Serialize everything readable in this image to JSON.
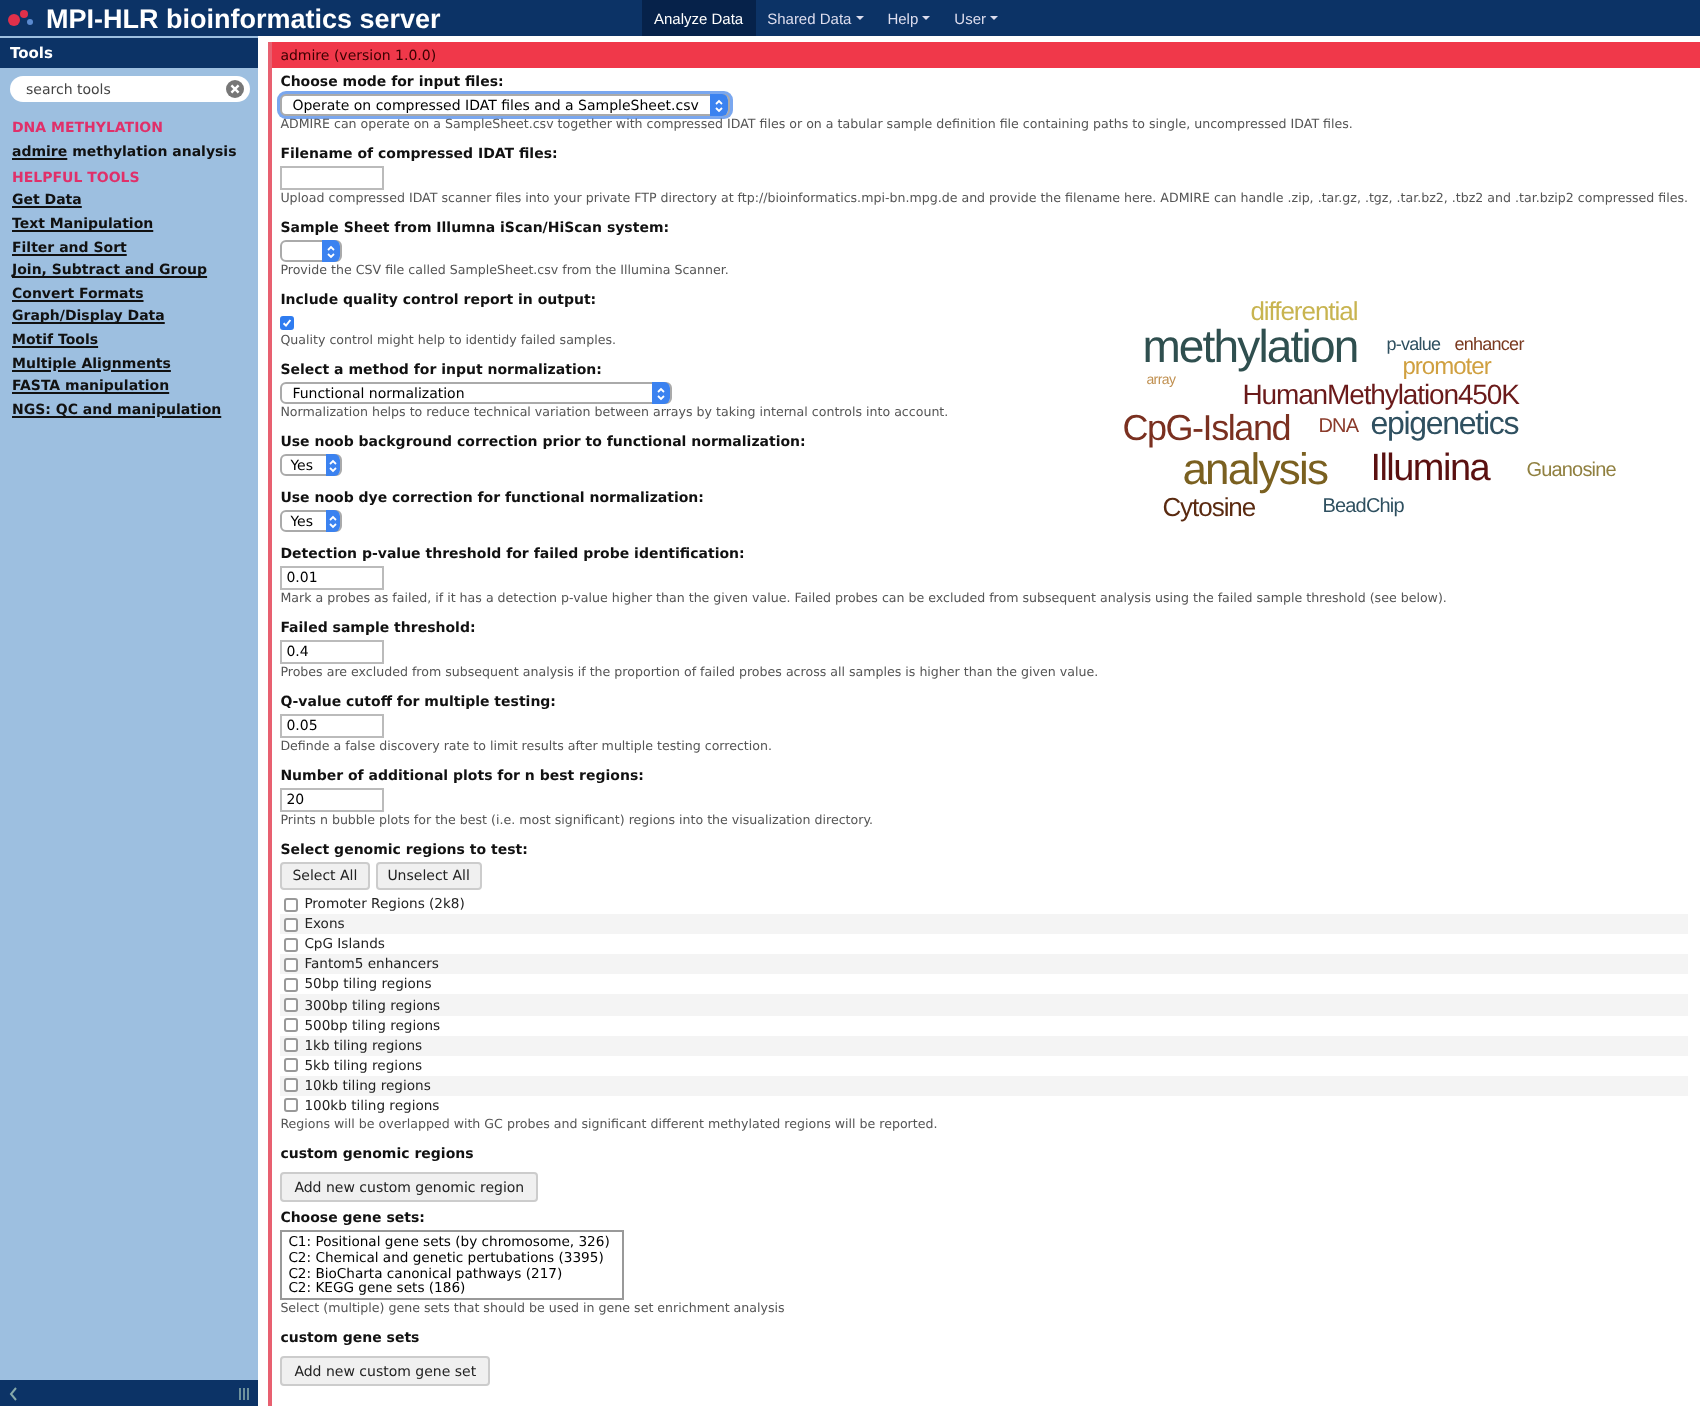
{
  "header": {
    "title": "MPI-HLR bioinformatics server",
    "nav": [
      {
        "label": "Analyze Data",
        "selected": true,
        "has_menu": false
      },
      {
        "label": "Shared Data",
        "selected": false,
        "has_menu": true
      },
      {
        "label": "Help",
        "selected": false,
        "has_menu": true
      },
      {
        "label": "User",
        "selected": false,
        "has_menu": true
      }
    ]
  },
  "sidebar": {
    "title": "Tools",
    "search": {
      "placeholder": "search tools"
    },
    "sections": [
      {
        "title": "DNA METHYLATION",
        "items": [
          {
            "link": "admire",
            "text": "methylation analysis"
          }
        ]
      },
      {
        "title": "HELPFUL TOOLS",
        "items": [
          {
            "link": "Get Data"
          },
          {
            "link": "Text Manipulation"
          },
          {
            "link": "Filter and Sort"
          },
          {
            "link": "Join, Subtract and Group"
          },
          {
            "link": "Convert Formats"
          },
          {
            "link": "Graph/Display Data"
          },
          {
            "link": "Motif Tools"
          },
          {
            "link": "Multiple Alignments"
          },
          {
            "link": "FASTA manipulation"
          },
          {
            "link": "NGS: QC and manipulation"
          }
        ]
      }
    ]
  },
  "tool": {
    "title": "admire (version 1.0.0)",
    "fields": [
      {
        "kind": "select",
        "label": "Choose mode for input files:",
        "value": "Operate on compressed IDAT files and a SampleSheet.csv",
        "help": "ADMIRE can operate on a SampleSheet.csv together with compressed IDAT files or on a tabular sample definition file containing paths to single, uncompressed IDAT files."
      },
      {
        "kind": "text",
        "label": "Filename of compressed IDAT files:",
        "help": "Upload compressed IDAT scanner files into your private FTP directory at ftp://bioinformatics.mpi-bn.mpg.de and provide the filename here. ADMIRE can handle .zip, .tar.gz, .tgz, .tar.bz2, .tbz2 and .tar.bzip2 compressed files."
      },
      {
        "kind": "small-select",
        "label": "Sample Sheet from Illumna iScan/HiScan system:",
        "help": "Provide the CSV file called SampleSheet.csv from the Illumina Scanner."
      },
      {
        "kind": "checkbox",
        "label": "Include quality control report in output:",
        "checked": true,
        "help": "Quality control might help to identidy failed samples."
      },
      {
        "kind": "select",
        "label": "Select a method for input normalization:",
        "value": "Functional normalization",
        "help": "Normalization helps to reduce technical variation between arrays by taking internal controls into account."
      },
      {
        "kind": "small-select",
        "label": "Use noob background correction prior to functional normalization:",
        "value": "Yes"
      },
      {
        "kind": "small-select",
        "label": "Use noob dye correction for functional normalization:",
        "value": "Yes"
      },
      {
        "kind": "text",
        "label": "Detection p-value threshold for failed probe identification:",
        "value": "0.01",
        "help": "Mark a probes as failed, if it has a detection p-value higher than the given value. Failed probes can be excluded from subsequent analysis using the failed sample threshold (see below)."
      },
      {
        "kind": "text",
        "label": "Failed sample threshold:",
        "value": "0.4",
        "help": "Probes are excluded from subsequent analysis if the proportion of failed probes across all samples is higher than the given value."
      },
      {
        "kind": "text",
        "label": "Q-value cutoff for multiple testing:",
        "value": "0.05",
        "help": "Definde a false discovery rate to limit results after multiple testing correction."
      },
      {
        "kind": "text",
        "label": "Number of additional plots for n best regions:",
        "value": "20",
        "help": "Prints n bubble plots for the best (i.e. most significant) regions into the visualization directory."
      },
      {
        "kind": "checklist",
        "label": "Select genomic regions to test:",
        "buttons": [
          "Select All",
          "Unselect All"
        ],
        "options": [
          {
            "label": "Promoter Regions (2k8)",
            "checked": false
          },
          {
            "label": "Exons",
            "checked": false
          },
          {
            "label": "CpG Islands",
            "checked": false
          },
          {
            "label": "Fantom5 enhancers",
            "checked": false
          },
          {
            "label": "50bp tiling regions",
            "checked": false
          },
          {
            "label": "300bp tiling regions",
            "checked": false
          },
          {
            "label": "500bp tiling regions",
            "checked": false
          },
          {
            "label": "1kb tiling regions",
            "checked": false
          },
          {
            "label": "5kb tiling regions",
            "checked": false
          },
          {
            "label": "10kb tiling regions",
            "checked": false
          },
          {
            "label": "100kb tiling regions",
            "checked": false
          }
        ],
        "help": "Regions will be overlapped with GC probes and significant different methylated regions will be reported."
      },
      {
        "kind": "button",
        "label": "custom genomic regions",
        "button": "Add new custom genomic region"
      },
      {
        "kind": "listbox",
        "label": "Choose gene sets:",
        "options": [
          "C1: Positional gene sets (by chromosome, 326)",
          "C2: Chemical and genetic pertubations (3395)",
          "C2: BioCharta canonical pathways (217)",
          "C2: KEGG gene sets (186)"
        ],
        "help": "Select (multiple) gene sets that should be used in gene set enrichment analysis"
      },
      {
        "kind": "button",
        "label": "custom gene sets",
        "button": "Add new custom gene set"
      }
    ]
  },
  "word_cloud": [
    {
      "text": "differential",
      "color": "#c8b450"
    },
    {
      "text": "methylation",
      "color": "#2f4f4f"
    },
    {
      "text": "p-value",
      "color": "#2f5060"
    },
    {
      "text": "enhancer",
      "color": "#7a3a20"
    },
    {
      "text": "promoter",
      "color": "#d0a040"
    },
    {
      "text": "array",
      "color": "#c09050"
    },
    {
      "text": "HumanMethylation450K",
      "color": "#6a1a1a"
    },
    {
      "text": "CpG-Island",
      "color": "#7a3020"
    },
    {
      "text": "DNA",
      "color": "#8a3a2a"
    },
    {
      "text": "epigenetics",
      "color": "#2f5060"
    },
    {
      "text": "analysis",
      "color": "#7a6020"
    },
    {
      "text": "Illumina",
      "color": "#5a1010"
    },
    {
      "text": "Guanosine",
      "color": "#908040"
    },
    {
      "text": "Cytosine",
      "color": "#5a2a10"
    },
    {
      "text": "BeadChip",
      "color": "#2f5060"
    }
  ]
}
